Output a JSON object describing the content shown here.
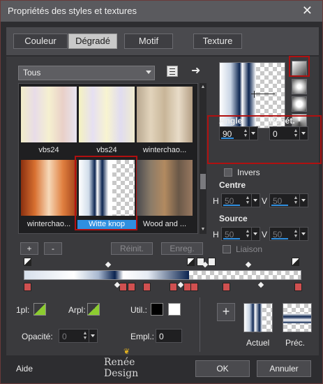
{
  "window": {
    "title": "Propriétés des styles et textures"
  },
  "tabs": [
    {
      "label": "Couleur"
    },
    {
      "label": "Dégradé"
    },
    {
      "label": "Motif"
    },
    {
      "label": "Texture"
    }
  ],
  "category_select": {
    "value": "Tous"
  },
  "gradients": [
    {
      "label": "vbs24"
    },
    {
      "label": "vbs24"
    },
    {
      "label": "winterchao..."
    },
    {
      "label": "winterchao..."
    },
    {
      "label": "Witte knop",
      "selected": true
    },
    {
      "label": "Wood and ..."
    }
  ],
  "list_buttons": {
    "add": "+",
    "remove": "-",
    "reset": "Réinit.",
    "save": "Enreg."
  },
  "angle": {
    "label": "Angle",
    "value": "90"
  },
  "repeat": {
    "label": "Répét.",
    "value": "0"
  },
  "invert": {
    "label": "Invers"
  },
  "center": {
    "label": "Centre",
    "h_label": "H",
    "h_value": "50",
    "v_label": "V",
    "v_value": "50"
  },
  "source": {
    "label": "Source",
    "h_label": "H",
    "h_value": "50",
    "v_label": "V",
    "v_value": "50"
  },
  "link": {
    "label": "Liaison"
  },
  "foreground": {
    "label": "1pl:"
  },
  "background": {
    "label": "Arpl:"
  },
  "user": {
    "label": "Util.:"
  },
  "opacity": {
    "label": "Opacité:",
    "value": "0"
  },
  "location": {
    "label": "Empl.:",
    "value": "0"
  },
  "compare": {
    "add": "+",
    "current_label": "Actuel",
    "previous_label": "Préc."
  },
  "logo": {
    "text": "Renée Design"
  },
  "footer": {
    "help": "Aide",
    "ok": "OK",
    "cancel": "Annuler"
  },
  "colors": {
    "accent_red": "#b01010",
    "selection_blue": "#2f8fe0",
    "navy": "#0b2450"
  }
}
